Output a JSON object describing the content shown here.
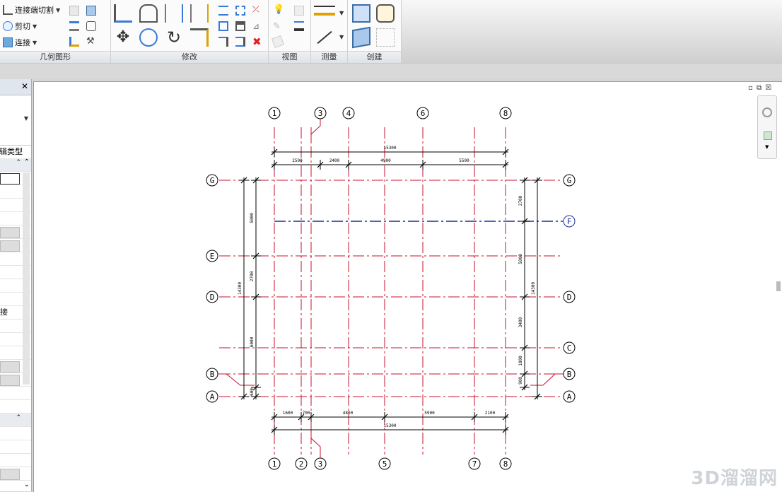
{
  "ribbon": {
    "geometry_panel": {
      "title": "几何图形",
      "buttons": [
        {
          "label": "连接端切割",
          "icon": "join-cut-icon"
        },
        {
          "label": "剪切",
          "icon": "cut-icon"
        },
        {
          "label": "连接",
          "icon": "join-icon"
        }
      ]
    },
    "modify_panel": {
      "title": "修改"
    },
    "view_panel": {
      "title": "视图"
    },
    "measure_panel": {
      "title": "测量"
    },
    "create_panel": {
      "title": "创建"
    }
  },
  "properties": {
    "edit_type_label": "编辑类型",
    "join_label": "接"
  },
  "window_controls": "▫ ⧉ ☒",
  "watermark": "3D溜溜网",
  "plan": {
    "top_grid_labels": [
      "1",
      "3",
      "4",
      "6",
      "8"
    ],
    "bottom_grid_labels": [
      "1",
      "2",
      "3",
      "5",
      "7",
      "8"
    ],
    "left_grid_labels": [
      "G",
      "E",
      "D",
      "B",
      "A"
    ],
    "right_grid_labels": [
      "G",
      "F",
      "D",
      "C",
      "B",
      "A"
    ],
    "top_total_dim": "15300",
    "top_dims": [
      "2500",
      "2400",
      "4900",
      "5500"
    ],
    "bottom_total_dim": "15300",
    "bottom_dims": [
      "1600",
      "700",
      "4800",
      "5900",
      "2100"
    ],
    "left_total_dim": "14300",
    "left_dims": [
      "5000",
      "2700",
      "6000",
      "600"
    ],
    "right_total_dim": "14300",
    "right_dims": [
      "2700",
      "5000",
      "3400",
      "1800",
      "900"
    ],
    "colors": {
      "grid": "#c8102e",
      "selected_grid": "#1c2d9c",
      "dim": "#000000"
    }
  }
}
